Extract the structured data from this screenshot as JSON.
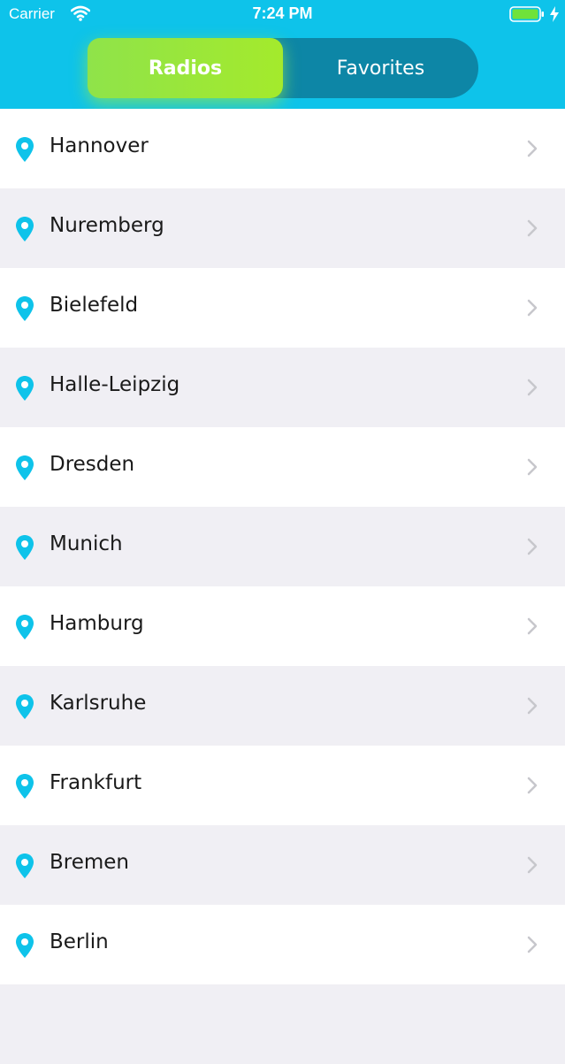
{
  "status_bar": {
    "carrier": "Carrier",
    "time": "7:24 PM"
  },
  "segmented_control": {
    "radios_label": "Radios",
    "favorites_label": "Favorites",
    "selected": "Radios"
  },
  "cities": [
    {
      "name": "Hannover"
    },
    {
      "name": "Nuremberg"
    },
    {
      "name": "Bielefeld"
    },
    {
      "name": "Halle-Leipzig"
    },
    {
      "name": "Dresden"
    },
    {
      "name": "Munich"
    },
    {
      "name": "Hamburg"
    },
    {
      "name": "Karlsruhe"
    },
    {
      "name": "Frankfurt"
    },
    {
      "name": "Bremen"
    },
    {
      "name": "Berlin"
    },
    {
      "name": ""
    }
  ],
  "colors": {
    "header": "#0ec3ea",
    "segment_track": "#0d86a6",
    "segment_active": "#a4ea2c",
    "pin": "#0ec3ea",
    "row_alt": "#f0eff4"
  },
  "icons": {
    "row_leading": "map-pin-icon",
    "row_trailing": "chevron-right-icon"
  }
}
